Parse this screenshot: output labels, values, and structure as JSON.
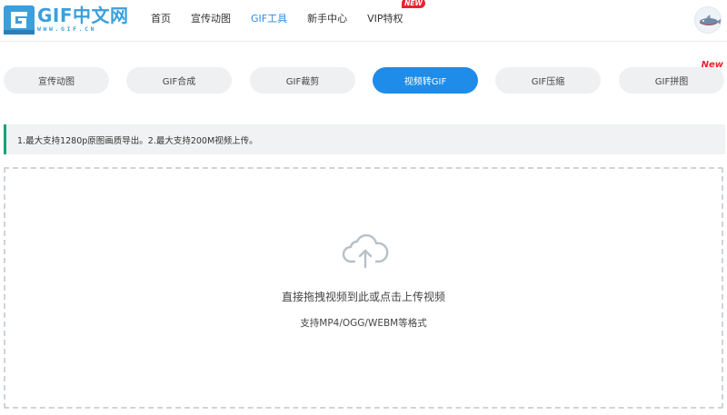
{
  "header": {
    "logo_title": "GIF中文网",
    "logo_url": "WWW.GIF.CN",
    "nav": [
      {
        "label": "首页"
      },
      {
        "label": "宣传动图"
      },
      {
        "label": "GIF工具"
      },
      {
        "label": "新手中心"
      },
      {
        "label": "VIP特权"
      }
    ],
    "vip_badge": "NEW"
  },
  "tabs": [
    {
      "label": "宣传动图"
    },
    {
      "label": "GIF合成"
    },
    {
      "label": "GIF裁剪"
    },
    {
      "label": "视频转GIF"
    },
    {
      "label": "GIF压缩"
    },
    {
      "label": "GIF拼图"
    }
  ],
  "tab_new_badge": "New",
  "notice": {
    "text": "1.最大支持1280p原图画质导出。2.最大支持200M视频上传。"
  },
  "upload": {
    "main_text": "直接拖拽视频到此或点击上传视频",
    "sub_text": "支持MP4/OGG/WEBM等格式"
  },
  "colors": {
    "accent": "#1e8ce8",
    "logo": "#3aa0dc",
    "new_badge": "#e8242c",
    "notice_border": "#16a37a"
  }
}
